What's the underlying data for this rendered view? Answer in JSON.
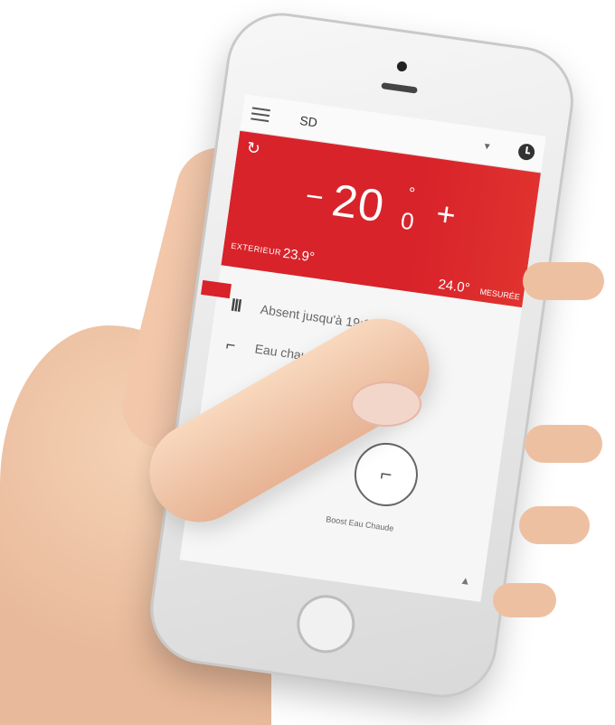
{
  "app": {
    "site_name": "SD"
  },
  "thermostat": {
    "temperature_main": "20",
    "temperature_decimal": "0",
    "degree_symbol": "°",
    "minus_symbol": "−",
    "plus_symbol": "+",
    "exterior_label": "EXTERIEUR",
    "exterior_value": "23.9°",
    "measured_value": "24.0°",
    "measured_label": "MESURÉE"
  },
  "status": [
    {
      "icon": "radiator-icon",
      "text": "Absent jusqu'à 19:00"
    },
    {
      "icon": "faucet-icon",
      "text": "Eau chaude ON jusqu'à 19:00"
    }
  ],
  "actions": {
    "boost_label": "Boost Eau Chaude"
  },
  "colors": {
    "accent": "#d8232a",
    "screen_bg": "#f6f6f6"
  }
}
